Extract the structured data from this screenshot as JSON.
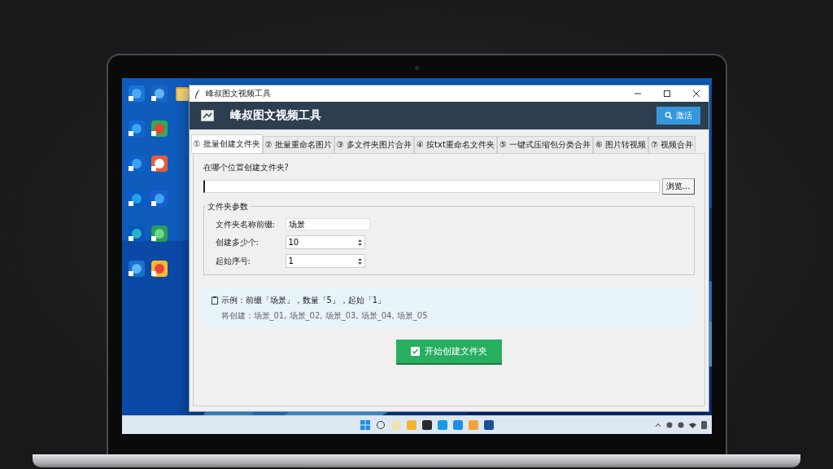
{
  "window": {
    "title": "峰叔图文视频工具"
  },
  "header": {
    "title": "峰叔图文视频工具",
    "activate_button": "激活"
  },
  "tabs": [
    {
      "label": "① 批量创建文件夹",
      "selected": true
    },
    {
      "label": "② 批量重命名图片",
      "selected": false
    },
    {
      "label": "③ 多文件夹图片合并",
      "selected": false
    },
    {
      "label": "④ 按txt重命名文件夹",
      "selected": false
    },
    {
      "label": "⑤ 一键式压缩包分类合并",
      "selected": false
    },
    {
      "label": "⑥ 图片转视频",
      "selected": false
    },
    {
      "label": "⑦ 视频合并",
      "selected": false
    }
  ],
  "location": {
    "question": "在哪个位置创建文件夹?",
    "browse_button": "浏览..."
  },
  "params": {
    "title": "文件夹参数",
    "fields": [
      {
        "label": "文件夹名称前缀:",
        "value": "场景",
        "kind": "text"
      },
      {
        "label": "创建多少个:",
        "value": "10",
        "kind": "spin"
      },
      {
        "label": "起始序号:",
        "value": "1",
        "kind": "spin"
      }
    ]
  },
  "example": {
    "title": "示例：前缀「场景」，数量「5」，起始「1」",
    "detail": "将创建：场景_01, 场景_02, 场景_03, 场景_04, 场景_05"
  },
  "start_button": "开始创建文件夹"
}
